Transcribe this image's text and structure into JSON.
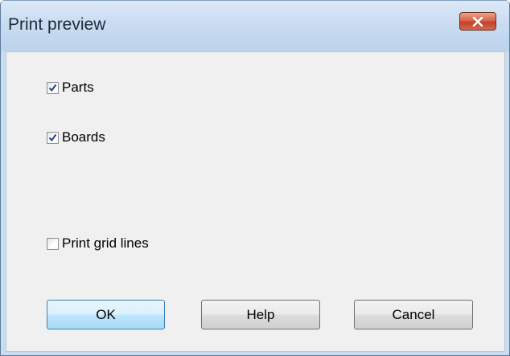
{
  "window": {
    "title": "Print preview",
    "close_icon": "close-icon"
  },
  "options": [
    {
      "label": "Parts",
      "checked": true
    },
    {
      "label": "Boards",
      "checked": true
    },
    {
      "label": "Print grid lines",
      "checked": false
    }
  ],
  "buttons": {
    "ok": "OK",
    "help": "Help",
    "cancel": "Cancel"
  },
  "colors": {
    "close_button": "#c3412a",
    "check_mark": "#1f3f8a",
    "titlebar": "#c9dcf1"
  }
}
